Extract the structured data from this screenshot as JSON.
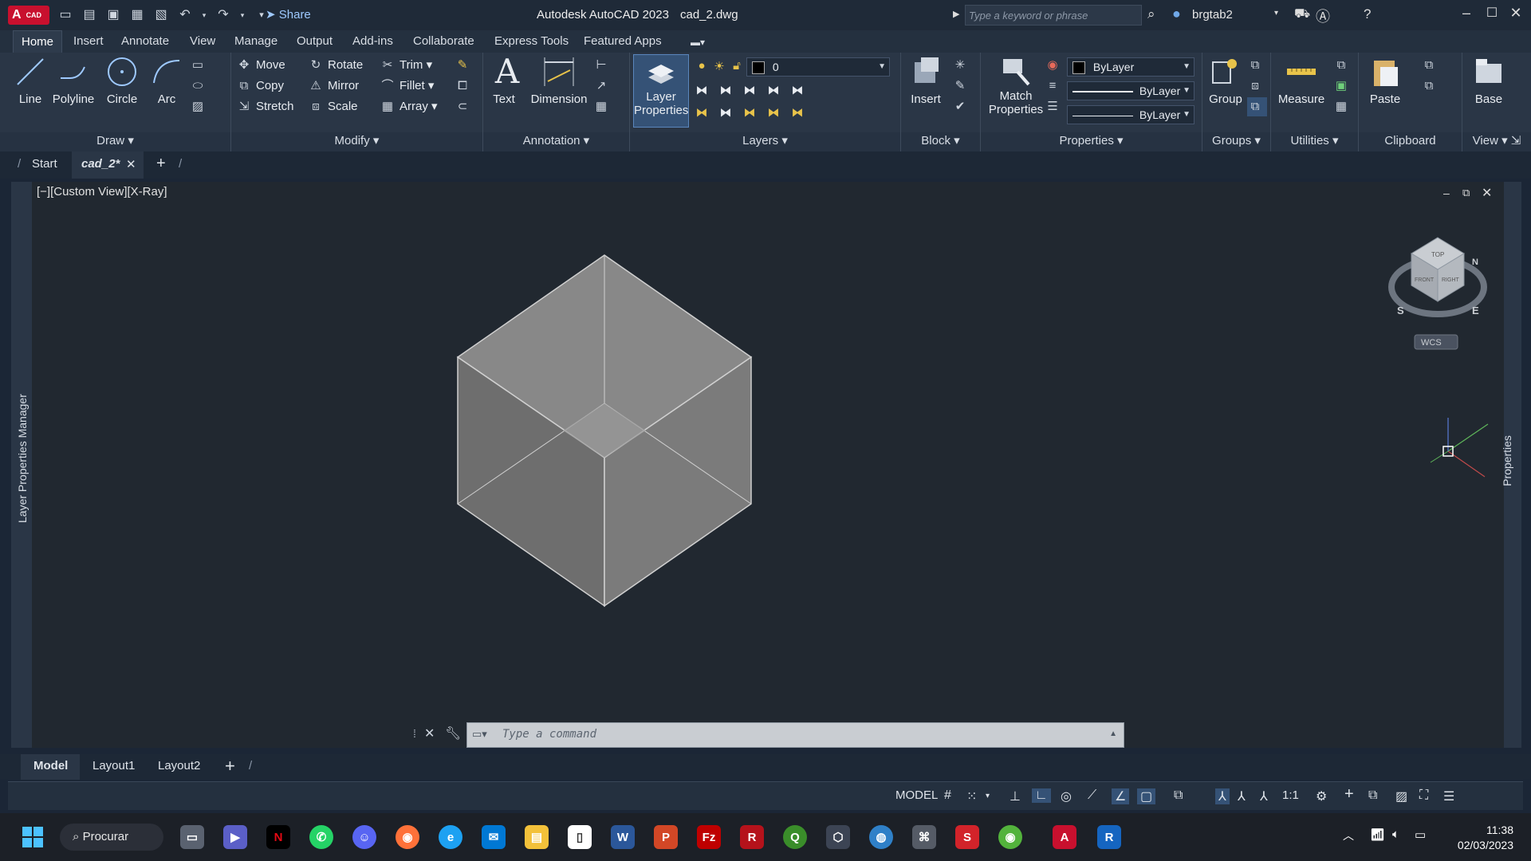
{
  "title_bar": {
    "app_logo": "A",
    "app_logo_sub": "CAD",
    "share": "Share",
    "window_title": "Autodesk AutoCAD 2023",
    "file_title": "cad_2.dwg",
    "search_placeholder": "Type a keyword or phrase",
    "user": "brgtab2"
  },
  "ribbon_tabs": [
    "Home",
    "Insert",
    "Annotate",
    "View",
    "Manage",
    "Output",
    "Add-ins",
    "Collaborate",
    "Express Tools",
    "Featured Apps"
  ],
  "draw": {
    "label": "Draw",
    "line": "Line",
    "polyline": "Polyline",
    "circle": "Circle",
    "arc": "Arc"
  },
  "modify": {
    "label": "Modify",
    "move": "Move",
    "rotate": "Rotate",
    "trim": "Trim",
    "copy": "Copy",
    "mirror": "Mirror",
    "fillet": "Fillet",
    "stretch": "Stretch",
    "scale": "Scale",
    "array": "Array"
  },
  "annotation": {
    "label": "Annotation",
    "text": "Text",
    "dimension": "Dimension"
  },
  "layers": {
    "label": "Layers",
    "layer_properties_1": "Layer",
    "layer_properties_2": "Properties",
    "current_layer": "0"
  },
  "block": {
    "label": "Block",
    "insert": "Insert"
  },
  "properties": {
    "label": "Properties",
    "match_1": "Match",
    "match_2": "Properties",
    "color": "ByLayer",
    "linetype": "ByLayer",
    "lineweight": "ByLayer"
  },
  "groups": {
    "label": "Groups",
    "group": "Group"
  },
  "utilities": {
    "label": "Utilities",
    "measure": "Measure"
  },
  "clipboard": {
    "label": "Clipboard",
    "paste": "Paste"
  },
  "view_panel": {
    "label": "View",
    "base": "Base"
  },
  "file_tabs": {
    "start": "Start",
    "active": "cad_2*"
  },
  "viewport": {
    "label": "[−][Custom View][X-Ray]",
    "wcs": "WCS",
    "viewcube_top": "TOP",
    "viewcube_front": "FRONT",
    "viewcube_right": "RIGHT",
    "compass_s": "S",
    "compass_e": "E",
    "compass_n": "N"
  },
  "palettes": {
    "left": "Layer Properties Manager",
    "right": "Properties"
  },
  "command_line": {
    "placeholder": "Type a command"
  },
  "layout_tabs": [
    "Model",
    "Layout1",
    "Layout2"
  ],
  "status_bar": {
    "model": "MODEL",
    "scale": "1:1"
  },
  "taskbar": {
    "search": "Procurar",
    "time": "11:38",
    "date": "02/03/2023"
  },
  "colors": {
    "cube_face_top": "#8a8a8a",
    "cube_face_left": "#6f6f6f",
    "cube_face_right": "#7c7c7c",
    "accent_blue": "#3c8dde",
    "autocad_red": "#c8102e"
  }
}
